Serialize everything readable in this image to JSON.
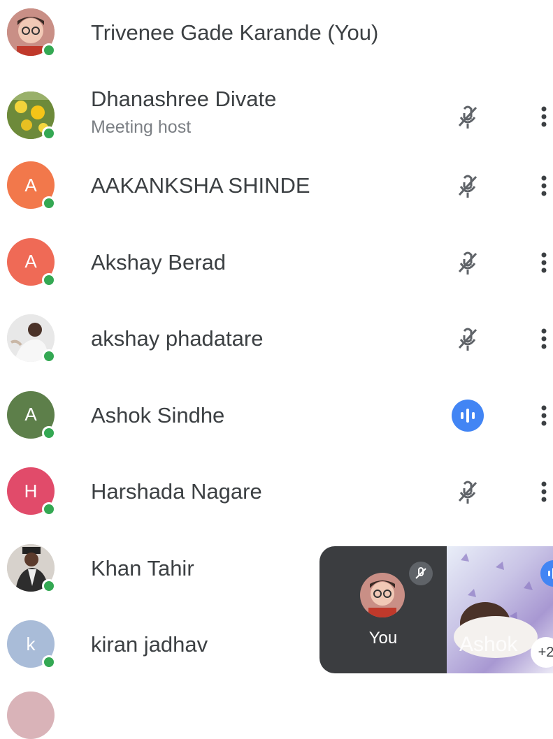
{
  "participants": [
    {
      "name": "Trivenee Gade Karande (You)",
      "subtitle": "",
      "initial": "",
      "avatar_color": "#c98f86",
      "avatar_type": "photo-child",
      "mic": "none",
      "more": false
    },
    {
      "name": "Dhanashree Divate",
      "subtitle": "Meeting host",
      "initial": "",
      "avatar_color": "#9aa84a",
      "avatar_type": "photo-flowers",
      "mic": "muted",
      "more": true
    },
    {
      "name": "AAKANKSHA SHINDE",
      "subtitle": "",
      "initial": "A",
      "avatar_color": "#f2784b",
      "avatar_type": "letter",
      "mic": "muted",
      "more": true
    },
    {
      "name": "Akshay Berad",
      "subtitle": "",
      "initial": "A",
      "avatar_color": "#ef6a56",
      "avatar_type": "letter",
      "mic": "muted",
      "more": true
    },
    {
      "name": "akshay phadatare",
      "subtitle": "",
      "initial": "",
      "avatar_color": "#e8e8e8",
      "avatar_type": "photo-person",
      "mic": "muted",
      "more": true
    },
    {
      "name": "Ashok Sindhe",
      "subtitle": "",
      "initial": "A",
      "avatar_color": "#5d7f4a",
      "avatar_type": "letter",
      "mic": "speaking",
      "more": true
    },
    {
      "name": "Harshada Nagare",
      "subtitle": "",
      "initial": "H",
      "avatar_color": "#e14b6a",
      "avatar_type": "letter",
      "mic": "muted",
      "more": true
    },
    {
      "name": "Khan Tahir",
      "subtitle": "",
      "initial": "",
      "avatar_color": "#d7d2cc",
      "avatar_type": "photo-person2",
      "mic": "none",
      "more": false
    },
    {
      "name": "kiran jadhav",
      "subtitle": "",
      "initial": "k",
      "avatar_color": "#a9bcd8",
      "avatar_type": "letter",
      "mic": "none",
      "more": false
    }
  ],
  "pip": {
    "self_label": "You",
    "remote_label": "Ashok",
    "more_count": "+2"
  },
  "colors": {
    "online_dot": "#34a853",
    "speaking": "#4285f4",
    "icon_gray": "#5f6368"
  },
  "icons": {
    "muted": "mic-off-icon",
    "speaking": "speaking-indicator-icon",
    "more": "more-vert-icon"
  }
}
